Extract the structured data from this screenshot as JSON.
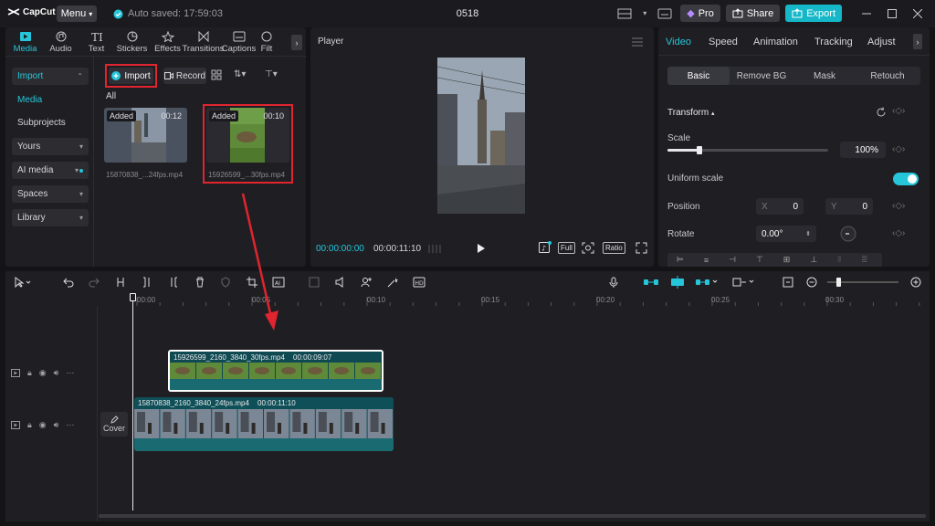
{
  "app": {
    "logo_text": "CapCut",
    "menu_label": "Menu",
    "autosave": "Auto saved: 17:59:03",
    "project_title": "0518",
    "pro_label": "Pro",
    "share_label": "Share",
    "export_label": "Export"
  },
  "media_tabs": [
    {
      "label": "Media",
      "icon": "media-icon"
    },
    {
      "label": "Audio",
      "icon": "audio-icon"
    },
    {
      "label": "Text",
      "icon": "text-icon"
    },
    {
      "label": "Stickers",
      "icon": "sticker-icon"
    },
    {
      "label": "Effects",
      "icon": "effects-icon"
    },
    {
      "label": "Transitions",
      "icon": "transitions-icon"
    },
    {
      "label": "Captions",
      "icon": "captions-icon"
    },
    {
      "label": "Filt",
      "icon": "filters-icon"
    }
  ],
  "sidebar": {
    "import": "Import",
    "media": "Media",
    "subprojects": "Subprojects",
    "yours": "Yours",
    "ai_media": "AI media",
    "spaces": "Spaces",
    "library": "Library"
  },
  "media_toolbar": {
    "import": "Import",
    "record": "Record",
    "filter_all": "All"
  },
  "media_items": [
    {
      "badge": "Added",
      "duration": "00:12",
      "filename": "15870838_...24fps.mp4"
    },
    {
      "badge": "Added",
      "duration": "00:10",
      "filename": "15926599_...30fps.mp4"
    }
  ],
  "player": {
    "title": "Player",
    "current_time": "00:00:00:00",
    "total_time": "00:00:11:10",
    "full_label": "Full",
    "ratio_label": "Ratio"
  },
  "props": {
    "tabs": [
      "Video",
      "Speed",
      "Animation",
      "Tracking",
      "Adjust"
    ],
    "subtabs": [
      "Basic",
      "Remove BG",
      "Mask",
      "Retouch"
    ],
    "transform": "Transform",
    "scale_label": "Scale",
    "scale_value": "100%",
    "scale_fraction": 0.2,
    "uniform_scale": "Uniform scale",
    "position_label": "Position",
    "pos_x_label": "X",
    "pos_x": "0",
    "pos_y_label": "Y",
    "pos_y": "0",
    "rotate_label": "Rotate",
    "rotate_value": "0.00°"
  },
  "timeline": {
    "ruler": [
      "00:00",
      "00:05",
      "00:10",
      "00:15",
      "00:20",
      "00:25",
      "00:30"
    ],
    "clip_top": {
      "name": "15926599_2160_3840_30fps.mp4",
      "duration": "00:00:09:07"
    },
    "clip_bottom": {
      "name": "15870838_2160_3840_24fps.mp4",
      "duration": "00:00:11:10"
    },
    "cover_label": "Cover"
  },
  "colors": {
    "accent": "#26c6da",
    "highlight_box": "#e02430",
    "clip_teal": "#1f6f78",
    "arrow": "#e02430"
  }
}
